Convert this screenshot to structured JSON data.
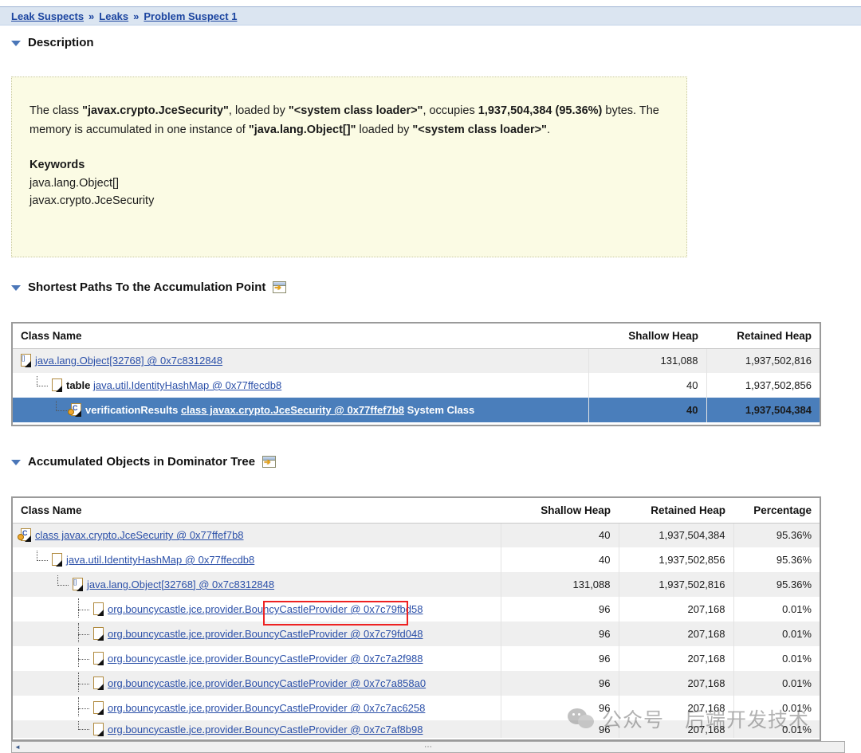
{
  "breadcrumb": {
    "items": [
      "Leak Suspects",
      "Leaks",
      "Problem Suspect 1"
    ],
    "separator": "»"
  },
  "sections": {
    "description": {
      "title": "Description"
    },
    "shortest_paths": {
      "title": "Shortest Paths To the Accumulation Point",
      "icon": "open-view-icon"
    },
    "dominator_tree": {
      "title": "Accumulated Objects in Dominator Tree",
      "icon": "open-view-icon"
    }
  },
  "description": {
    "paragraph": {
      "p1": "The class ",
      "class_name": "\"javax.crypto.JceSecurity\"",
      "p2": ", loaded by ",
      "loader": "\"<system class loader>\"",
      "p3": ", occupies ",
      "bytes": "1,937,504,384 (95.36%)",
      "p4": " bytes. The memory is accumulated in one instance of ",
      "instance": "\"java.lang.Object[]\"",
      "p5": " loaded by ",
      "loader2": "\"<system class loader>\"",
      "p6": "."
    },
    "keywords_title": "Keywords",
    "keywords": [
      "java.lang.Object[]",
      "javax.crypto.JceSecurity"
    ]
  },
  "shortest_paths_table": {
    "columns": [
      "Class Name",
      "Shallow Heap",
      "Retained Heap"
    ],
    "rows": [
      {
        "prefix": "",
        "link": "java.lang.Object[32768] @ 0x7c8312848",
        "suffix": "",
        "shallow": "131,088",
        "retained": "1,937,502,816",
        "depth": 0,
        "icon": "array-object-icon",
        "selected": false,
        "alt": true
      },
      {
        "prefix": "table",
        "link": "java.util.IdentityHashMap @ 0x77ffecdb8",
        "suffix": "",
        "shallow": "40",
        "retained": "1,937,502,856",
        "depth": 1,
        "icon": "object-icon",
        "selected": false,
        "alt": false
      },
      {
        "prefix": "verificationResults",
        "link": "class javax.crypto.JceSecurity @ 0x77ffef7b8",
        "suffix": "System Class",
        "shallow": "40",
        "retained": "1,937,504,384",
        "depth": 2,
        "icon": "class-object-icon",
        "selected": true,
        "alt": false
      }
    ]
  },
  "dominator_table": {
    "columns": [
      "Class Name",
      "Shallow Heap",
      "Retained Heap",
      "Percentage"
    ],
    "rows": [
      {
        "link": "class javax.crypto.JceSecurity @ 0x77ffef7b8",
        "shallow": "40",
        "retained": "1,937,504,384",
        "percentage": "95.36%",
        "depth": 0,
        "icon": "class-object-icon",
        "alt": true
      },
      {
        "link": "java.util.IdentityHashMap @ 0x77ffecdb8",
        "shallow": "40",
        "retained": "1,937,502,856",
        "percentage": "95.36%",
        "depth": 1,
        "icon": "object-icon",
        "alt": false
      },
      {
        "link": "java.lang.Object[32768] @ 0x7c8312848",
        "shallow": "131,088",
        "retained": "1,937,502,816",
        "percentage": "95.36%",
        "depth": 2,
        "icon": "array-object-icon",
        "alt": true
      },
      {
        "link": "org.bouncycastle.jce.provider.BouncyCastleProvider @ 0x7c79fbd58",
        "shallow": "96",
        "retained": "207,168",
        "percentage": "0.01%",
        "depth": 3,
        "icon": "object-icon",
        "alt": false
      },
      {
        "link": "org.bouncycastle.jce.provider.BouncyCastleProvider @ 0x7c79fd048",
        "shallow": "96",
        "retained": "207,168",
        "percentage": "0.01%",
        "depth": 3,
        "icon": "object-icon",
        "alt": true
      },
      {
        "link": "org.bouncycastle.jce.provider.BouncyCastleProvider @ 0x7c7a2f988",
        "shallow": "96",
        "retained": "207,168",
        "percentage": "0.01%",
        "depth": 3,
        "icon": "object-icon",
        "alt": false
      },
      {
        "link": "org.bouncycastle.jce.provider.BouncyCastleProvider @ 0x7c7a858a0",
        "shallow": "96",
        "retained": "207,168",
        "percentage": "0.01%",
        "depth": 3,
        "icon": "object-icon",
        "alt": true
      },
      {
        "link": "org.bouncycastle.jce.provider.BouncyCastleProvider @ 0x7c7ac6258",
        "shallow": "96",
        "retained": "207,168",
        "percentage": "0.01%",
        "depth": 3,
        "icon": "object-icon",
        "alt": false
      },
      {
        "link": "org.bouncycastle.jce.provider.BouncyCastleProvider @ 0x7c7af8b98",
        "shallow": "96",
        "retained": "207,168",
        "percentage": "0.01%",
        "depth": 3,
        "icon": "object-icon",
        "alt": true
      }
    ]
  },
  "annotation": {
    "type": "red-rectangle-highlight",
    "target": "BouncyCastleProvider @"
  },
  "watermark": {
    "text": "公众号　后端开发技术",
    "icon": "wechat-logo-icon"
  },
  "colors": {
    "breadcrumb_bg": "#dbe5f1",
    "link": "#2a4fa8",
    "selection": "#4a7ebb",
    "description_bg": "#fbfbe4",
    "annotation": "#ee2222"
  }
}
